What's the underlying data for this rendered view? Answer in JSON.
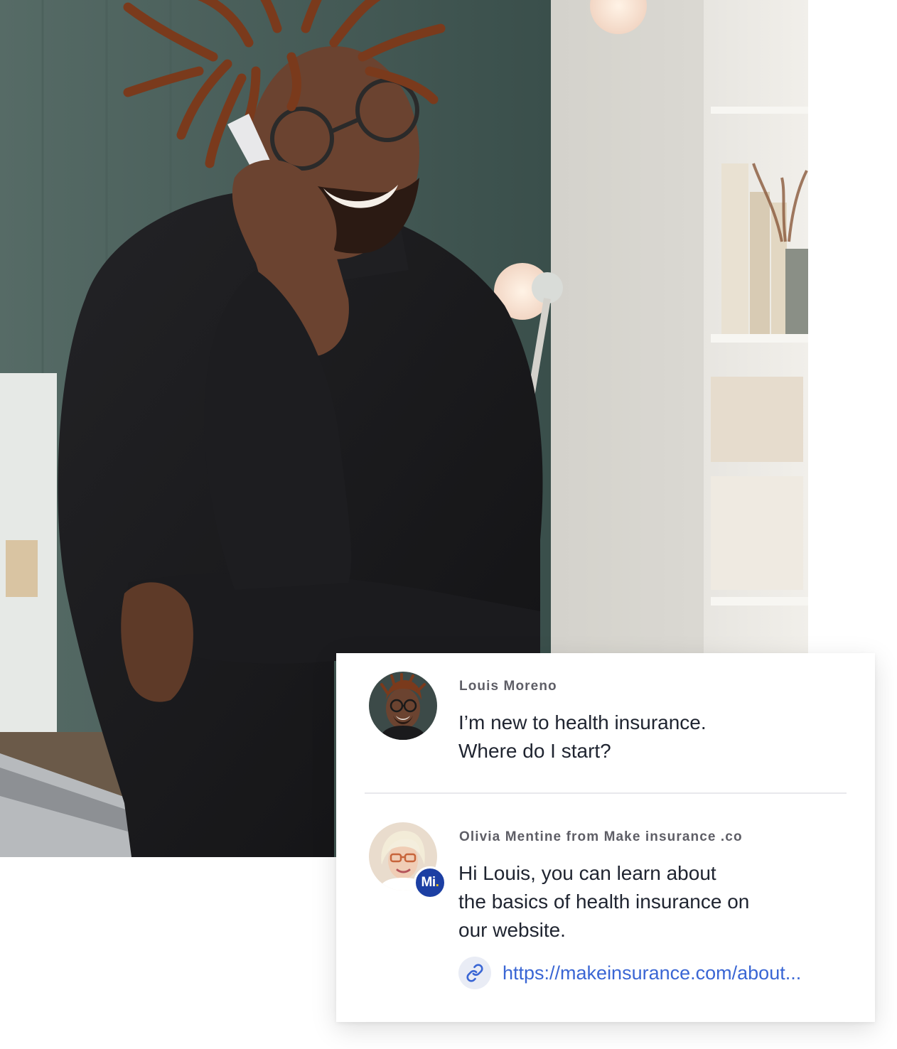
{
  "hero": {
    "icon": "person-on-phone-photo",
    "colors": {
      "wall": "#3f5551",
      "shelf": "#e8e6e1",
      "sweater": "#1a1a1c",
      "skin": "#6b4330",
      "hair": "#7a3a1c"
    }
  },
  "chat": {
    "messages": [
      {
        "sender": "Louis Moreno",
        "lines": [
          "I’m new to health insurance.",
          "Where do I start?"
        ],
        "avatar_icon": "louis-avatar"
      },
      {
        "sender": "Olivia Mentine from Make insurance .co",
        "lines": [
          "Hi Louis, you can learn about",
          "the basics of health insurance on",
          "our website."
        ],
        "avatar_icon": "olivia-avatar",
        "badge": {
          "text": "Mi",
          "dot": ".",
          "color": "#1c3fa3",
          "dot_color": "#f5c518"
        },
        "link": {
          "text": "https://makeinsurance.com/about...",
          "icon": "link-icon",
          "color": "#3a66d4"
        }
      }
    ]
  }
}
